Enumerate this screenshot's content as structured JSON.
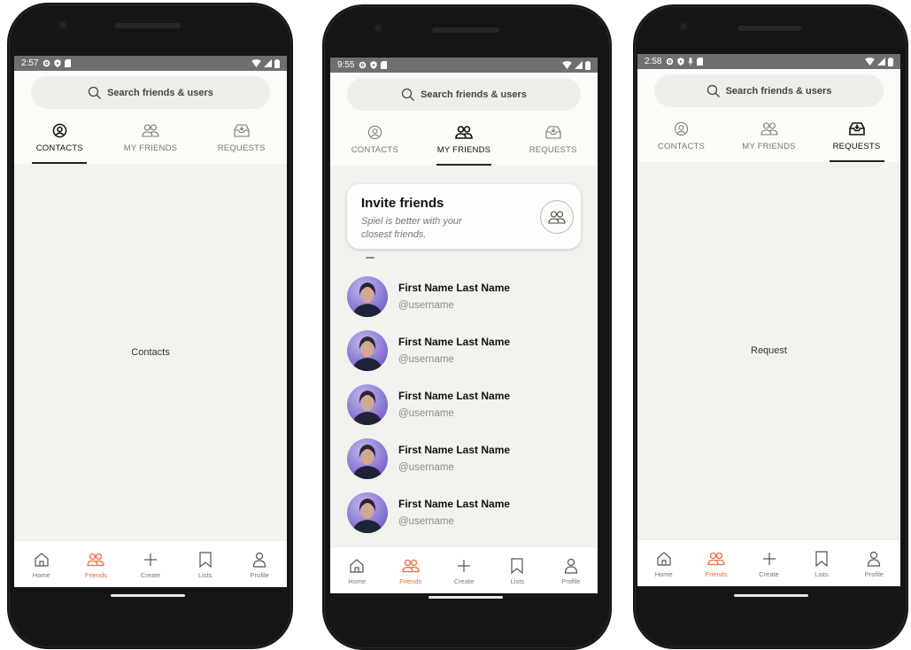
{
  "colors": {
    "accent": "#ec6b3d",
    "screen_bg": "#f2f2ef",
    "header_bg": "#fbfbf8",
    "status_bar": "#6f6f6f"
  },
  "search": {
    "label": "Search friends & users",
    "icon": "search-icon"
  },
  "tabs": [
    {
      "label": "CONTACTS",
      "icon": "user-circle-icon"
    },
    {
      "label": "MY FRIENDS",
      "icon": "friends-icon"
    },
    {
      "label": "REQUESTS",
      "icon": "inbox-icon"
    }
  ],
  "nav": [
    {
      "label": "Home",
      "icon": "home-icon"
    },
    {
      "label": "Friends",
      "icon": "friends-icon"
    },
    {
      "label": "Create",
      "icon": "plus-icon"
    },
    {
      "label": "Lists",
      "icon": "bookmark-icon"
    },
    {
      "label": "Profile",
      "icon": "profile-icon"
    }
  ],
  "screens": [
    {
      "time": "2:57",
      "active_tab": "CONTACTS",
      "active_nav": "Friends",
      "body_text": "Contacts"
    },
    {
      "time": "9:55",
      "active_tab": "MY FRIENDS",
      "active_nav": "Friends",
      "invite": {
        "title": "Invite friends",
        "subtitle": "Spiel is better with your closest friends.",
        "icon": "friends-icon"
      },
      "friends": [
        {
          "name": "First Name Last Name",
          "username": "@username"
        },
        {
          "name": "First Name Last Name",
          "username": "@username"
        },
        {
          "name": "First Name Last Name",
          "username": "@username"
        },
        {
          "name": "First Name Last Name",
          "username": "@username"
        },
        {
          "name": "First Name Last Name",
          "username": "@username"
        }
      ]
    },
    {
      "time": "2:58",
      "active_tab": "REQUESTS",
      "active_nav": "Friends",
      "body_text": "Request"
    }
  ]
}
